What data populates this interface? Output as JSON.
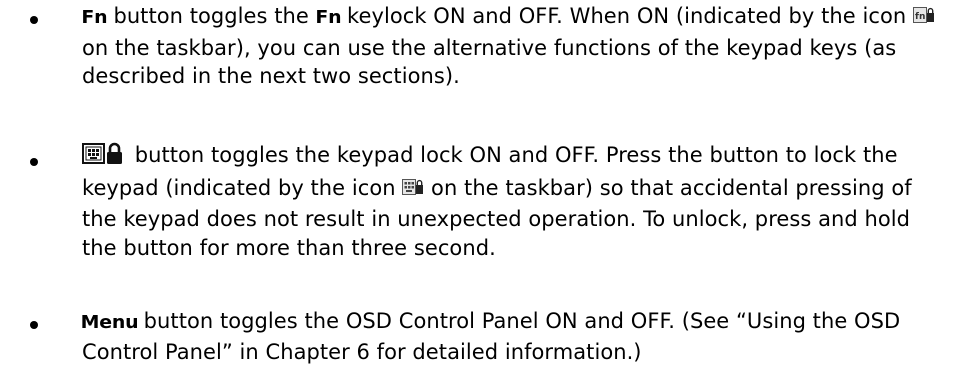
{
  "items": [
    {
      "key_label": "Fn",
      "text_1": " button toggles the ",
      "key_label_2": "Fn",
      "text_2": " keylock ON and OFF. When ON (indicated by the icon ",
      "icon_1": "fn-lock-taskbar-icon",
      "text_3": " on the taskbar), you can use the alternative functions of the keypad keys (as described in the next two sections)."
    },
    {
      "icon_button": "keypad-lock-button-icon",
      "text_1": " button toggles the keypad lock ON and OFF. Press the button to lock the keypad (indicated by the icon ",
      "icon_1": "keypad-lock-taskbar-icon",
      "text_2": " on the taskbar) so that accidental pressing of the keypad does not result in unexpected operation. To unlock, press and hold the button for more than three second."
    },
    {
      "key_label": "Menu",
      "text_1": " button toggles the OSD Control Panel ON and OFF. (See “Using the OSD Control Panel” in Chapter 6 for detailed information.)"
    }
  ]
}
